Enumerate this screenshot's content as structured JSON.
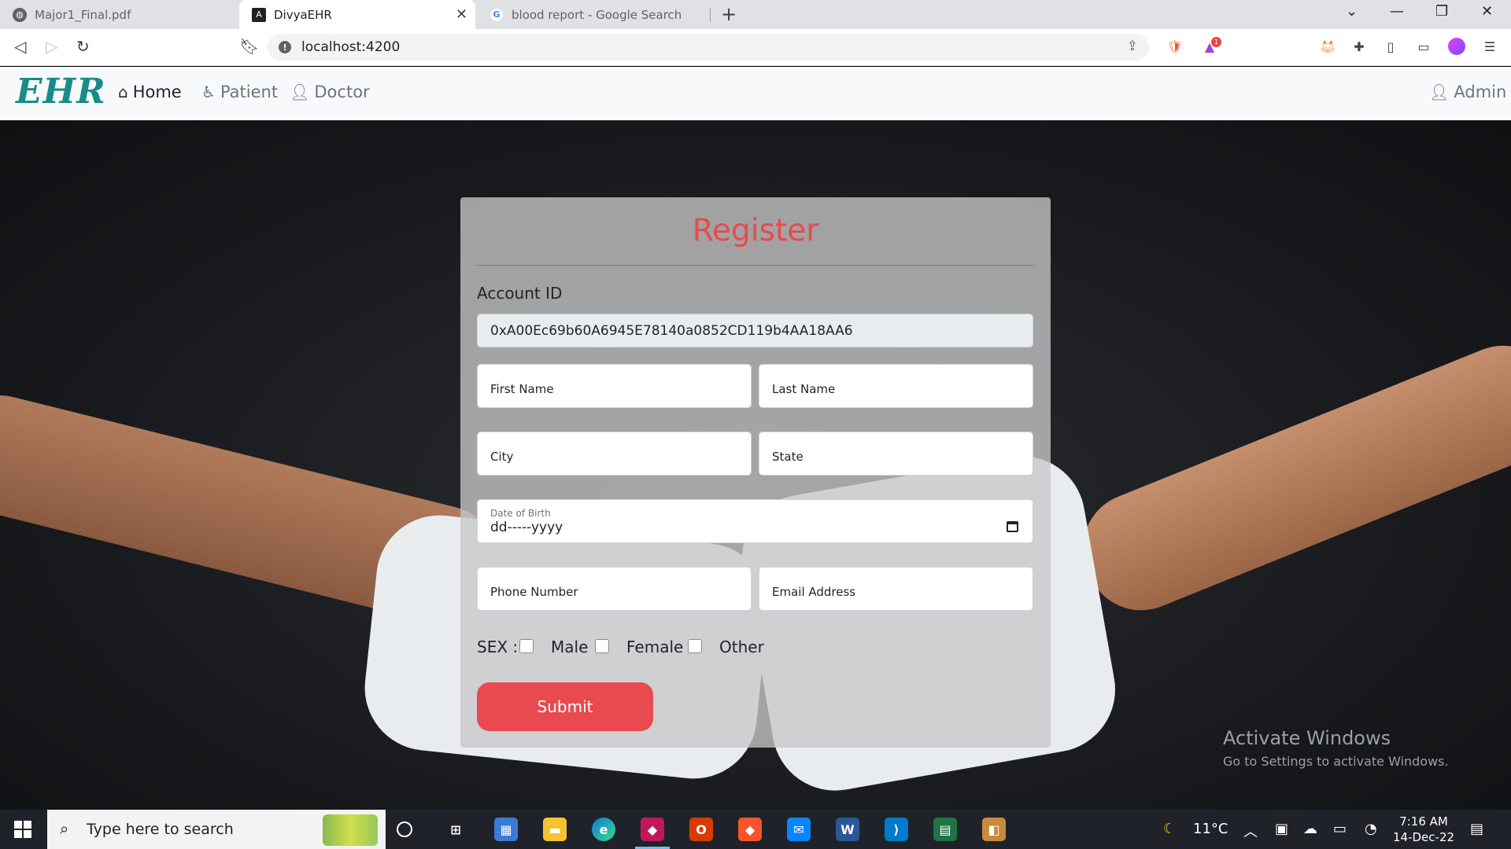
{
  "browser": {
    "tabs": [
      {
        "title": "Major1_Final.pdf",
        "favicon": "globe-icon"
      },
      {
        "title": "DivyaEHR",
        "favicon": "angular-icon",
        "active": true
      },
      {
        "title": "blood report - Google Search",
        "favicon": "google-icon"
      }
    ],
    "url": "localhost:4200",
    "notification_badge": "1"
  },
  "navbar": {
    "logo": "EHR",
    "links": [
      {
        "label": "Home",
        "icon": "home-icon",
        "active": true
      },
      {
        "label": "Patient",
        "icon": "patient-icon"
      },
      {
        "label": "Doctor",
        "icon": "doctor-icon"
      }
    ],
    "admin_label": "Admin"
  },
  "register": {
    "title": "Register",
    "account_label": "Account ID",
    "account_value": "0xA00Ec69b60A6945E78140a0852CD119b4AA18AA6",
    "first_name_placeholder": "First Name",
    "last_name_placeholder": "Last Name",
    "city_placeholder": "City",
    "state_placeholder": "State",
    "dob_label": "Date of Birth",
    "dob_value": "dd-----yyyy",
    "phone_placeholder": "Phone Number",
    "email_placeholder": "Email Address",
    "sex_label": "SEX :",
    "sex_options": [
      "Male",
      "Female",
      "Other"
    ],
    "submit_label": "Submit"
  },
  "watermark": {
    "line1": "Activate Windows",
    "line2": "Go to Settings to activate Windows."
  },
  "taskbar": {
    "search_placeholder": "Type here to search",
    "weather": "11°C",
    "time": "7:16 AM",
    "date": "14-Dec-22"
  },
  "colors": {
    "accent": "#e84a4f",
    "logo": "#1b8a8a",
    "card_bg": "#c8c8c8"
  }
}
